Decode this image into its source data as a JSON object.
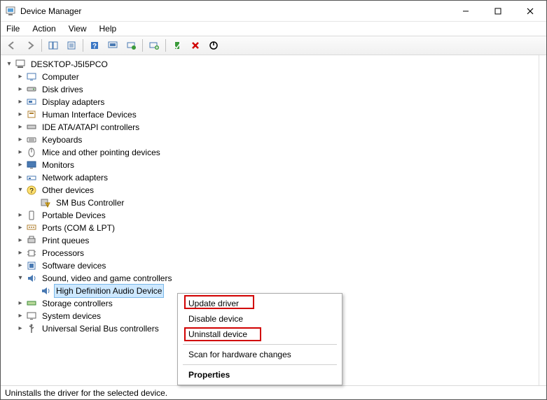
{
  "window": {
    "title": "Device Manager"
  },
  "menubar": {
    "file": "File",
    "action": "Action",
    "view": "View",
    "help": "Help"
  },
  "tree": {
    "root": "DESKTOP-J5I5PCO",
    "items": [
      "Computer",
      "Disk drives",
      "Display adapters",
      "Human Interface Devices",
      "IDE ATA/ATAPI controllers",
      "Keyboards",
      "Mice and other pointing devices",
      "Monitors",
      "Network adapters",
      "Other devices",
      "Portable Devices",
      "Ports (COM & LPT)",
      "Print queues",
      "Processors",
      "Software devices",
      "Sound, video and game controllers",
      "Storage controllers",
      "System devices",
      "Universal Serial Bus controllers"
    ],
    "other_child": "SM Bus Controller",
    "sound_child": "High Definition Audio Device"
  },
  "contextmenu": {
    "update": "Update driver",
    "disable": "Disable device",
    "uninstall": "Uninstall device",
    "scan": "Scan for hardware changes",
    "properties": "Properties"
  },
  "statusbar": {
    "text": "Uninstalls the driver for the selected device."
  }
}
